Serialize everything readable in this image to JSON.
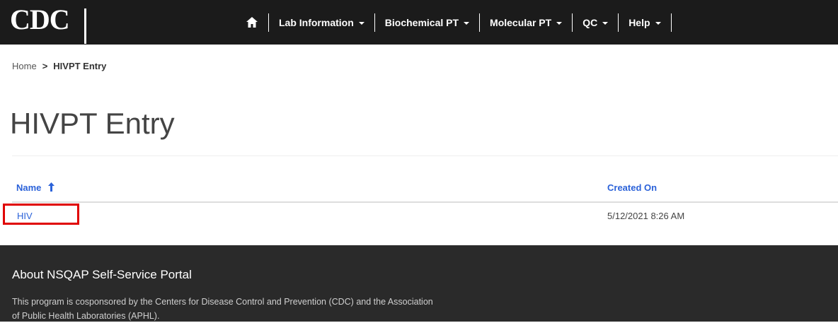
{
  "header": {
    "logo_text": "CDC",
    "nav": {
      "home_icon": "home-icon",
      "items": [
        {
          "label": "Lab Information"
        },
        {
          "label": "Biochemical PT"
        },
        {
          "label": "Molecular PT"
        },
        {
          "label": "QC"
        },
        {
          "label": "Help"
        }
      ]
    }
  },
  "breadcrumb": {
    "home": "Home",
    "separator": ">",
    "current": "HIVPT Entry"
  },
  "page": {
    "title": "HIVPT Entry"
  },
  "table": {
    "columns": [
      {
        "label": "Name",
        "sort_icon": "arrow-up-icon"
      },
      {
        "label": "Created On"
      }
    ],
    "rows": [
      {
        "name": "HIV",
        "created_on": "5/12/2021 8:26 AM"
      }
    ]
  },
  "footer": {
    "title": "About NSQAP Self-Service Portal",
    "text": "This program is cosponsored by the Centers for Disease Control and Prevention (CDC) and the Association of Public Health Laboratories (APHL)."
  },
  "colors": {
    "topbar": "#1b1b1b",
    "link": "#2b62d9",
    "footer": "#2a2a2a",
    "highlight": "#e00000"
  }
}
